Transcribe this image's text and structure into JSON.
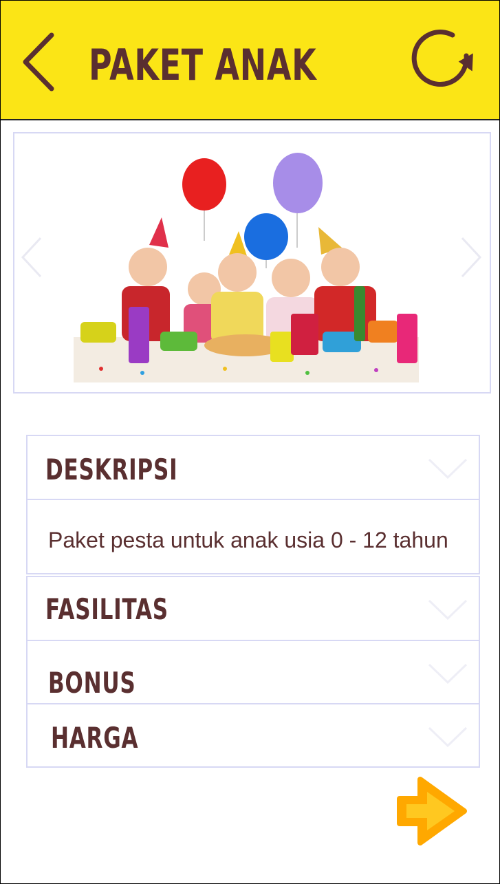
{
  "header": {
    "title": "PAKET ANAK",
    "background_color": "#fbe516",
    "text_color": "#5a2f30",
    "back_icon": "chevron-left-icon",
    "refresh_icon": "refresh-icon"
  },
  "carousel": {
    "prev_icon": "chevron-left-icon",
    "next_icon": "chevron-right-icon",
    "image": "kids-birthday-party-photo"
  },
  "accordion": {
    "border_color": "#d7d8f4",
    "sections": [
      {
        "label": "DESKRIPSI",
        "expanded": true,
        "content": "Paket pesta untuk anak usia 0 - 12 tahun"
      },
      {
        "label": "FASILITAS",
        "expanded": false
      },
      {
        "label": "BONUS",
        "expanded": false
      },
      {
        "label": "HARGA",
        "expanded": false
      }
    ]
  },
  "footer": {
    "next_icon": "arrow-right-icon",
    "next_color": "#ffa800"
  }
}
